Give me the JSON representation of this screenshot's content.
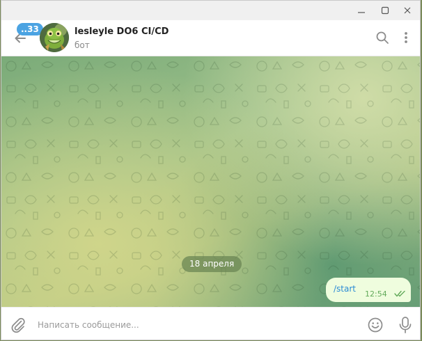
{
  "window": {
    "controls": {
      "minimize_icon": "minimize-icon",
      "maximize_icon": "maximize-icon",
      "close_icon": "close-icon"
    }
  },
  "header": {
    "unread_count": "..33",
    "title": "lesleyle DO6 CI/CD",
    "subtitle": "бот",
    "back_icon": "arrow-left-icon",
    "search_icon": "search-icon",
    "more_icon": "more-vertical-icon"
  },
  "chat": {
    "date_separator": "18 апреля",
    "messages": [
      {
        "text": "/start",
        "time": "12:54",
        "status": "read",
        "outgoing": true
      }
    ]
  },
  "composer": {
    "placeholder": "Написать сообщение...",
    "value": "",
    "attach_icon": "paperclip-icon",
    "emoji_icon": "emoji-icon",
    "mic_icon": "microphone-icon"
  },
  "colors": {
    "accent": "#4ba3e2",
    "bubble_out": "#effdde",
    "bubble_time": "#62aa5a",
    "command_link": "#2a8bd5"
  }
}
